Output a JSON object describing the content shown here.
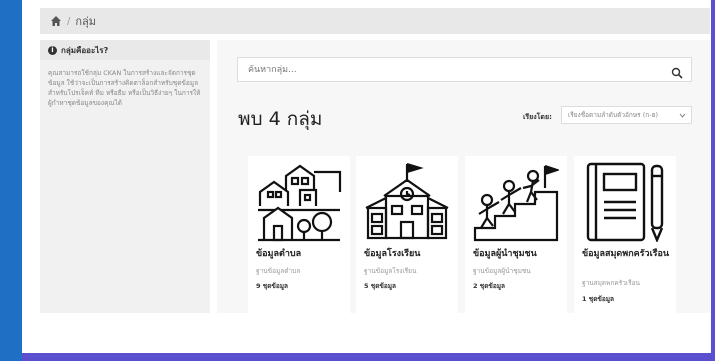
{
  "breadcrumb": {
    "home_icon": "home-icon",
    "current": "กลุ่ม"
  },
  "sidebar": {
    "heading": "กลุ่มคืออะไร?",
    "heading_icon": "info-icon",
    "body": "คุณสามารถใช้กลุ่ม CKAN ในการสร้างและจัดการชุดข้อมูล ใช้ว่าจะเป็นการสร้างคิดตาล็อกสำหรับชุดข้อมูลสำหรับโปรเจ็คท์ ทีม หรือธีม หรือเป็นวิธีง่ายๆ ในการให้ผู้กำหาชุดข้อมูลของคุณได้"
  },
  "search": {
    "placeholder": "ค้นหากลุ่ม...",
    "icon": "search-icon"
  },
  "results": {
    "title": "พบ 4 กลุ่ม"
  },
  "sort": {
    "label": "เรียงโดย:",
    "selected": "เรียงชื่อตามลำดับตัวอักษร (ก-ฮ)"
  },
  "groups": [
    {
      "title": "ข้อมูลตำบล",
      "description": "ฐานข้อมูลตำบล",
      "count": "9 ชุดข้อมูล",
      "icon": "village-houses-icon"
    },
    {
      "title": "ข้อมูลโรงเรียน",
      "description": "ฐานข้อมูลโรงเรียน",
      "count": "5 ชุดข้อมูล",
      "icon": "school-building-icon"
    },
    {
      "title": "ข้อมูลผู้นำชุมชน",
      "description": "ฐานข้อมูลผู้นำชุมชน",
      "count": "2 ชุดข้อมูล",
      "icon": "leaders-climbing-icon"
    },
    {
      "title": "ข้อมูลสมุดพกครัวเรือน",
      "description": "ฐานสมุดพกครัวเรือน",
      "count": "1 ชุดข้อมูล",
      "icon": "notebook-icon"
    }
  ],
  "colors": {
    "frame_left": "#1f6fc4",
    "frame_accent": "#5a4fcf"
  }
}
